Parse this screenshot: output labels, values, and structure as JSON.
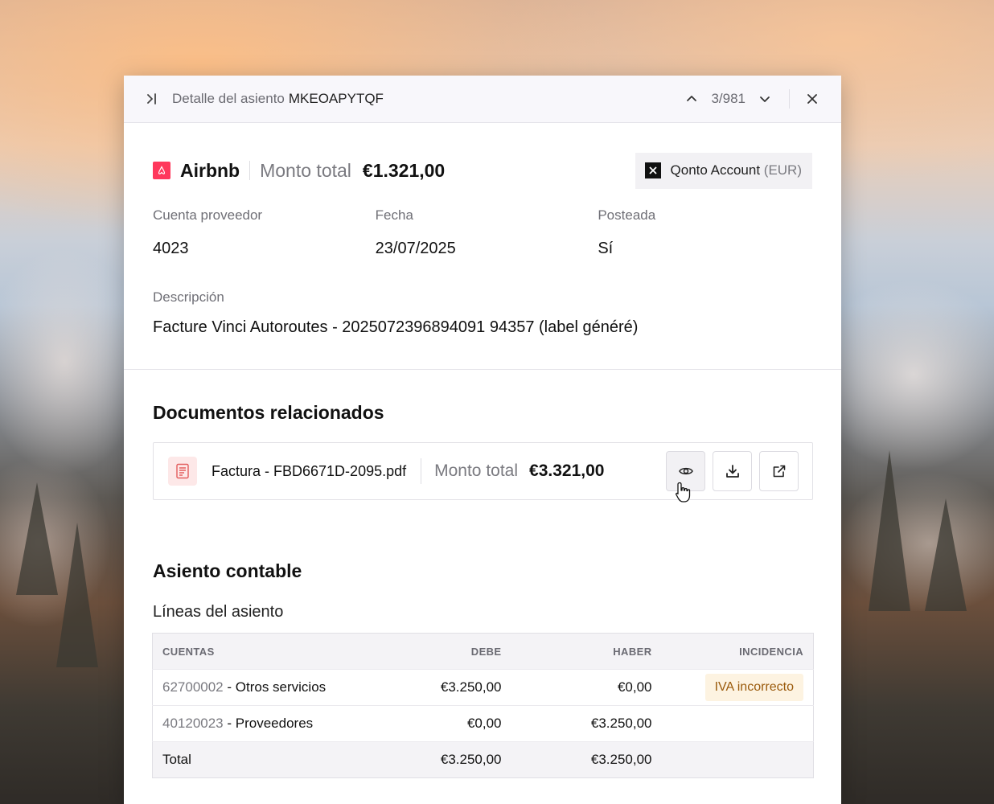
{
  "topbar": {
    "title_prefix": "Detalle del asiento",
    "entry_code": "MKEOAPYTQF",
    "pager": "3/981"
  },
  "entry": {
    "vendor": "Airbnb",
    "total_label": "Monto total",
    "total_value": "€1.321,00",
    "account_name": "Qonto Account",
    "account_currency": "(EUR)",
    "fields": [
      {
        "label": "Cuenta proveedor",
        "value": "4023"
      },
      {
        "label": "Fecha",
        "value": "23/07/2025"
      },
      {
        "label": "Posteada",
        "value": "Sí"
      }
    ],
    "description_label": "Descripción",
    "description_value": "Facture Vinci Autoroutes - 2025072396894091 94357 (label généré)"
  },
  "documents": {
    "title": "Documentos relacionados",
    "items": [
      {
        "name": "Factura - FBD6671D-2095.pdf",
        "total_label": "Monto total",
        "total_value": "€3.321,00"
      }
    ]
  },
  "accounting": {
    "title": "Asiento contable",
    "subtitle": "Líneas del asiento",
    "columns": [
      "CUENTAS",
      "DEBE",
      "HABER",
      "INCIDENCIA"
    ],
    "rows": [
      {
        "code": "62700002",
        "name": "- Otros servicios",
        "debit": "€3.250,00",
        "credit": "€0,00",
        "issue": "IVA incorrecto"
      },
      {
        "code": "40120023",
        "name": "- Proveedores",
        "debit": "€0,00",
        "credit": "€3.250,00",
        "issue": ""
      }
    ],
    "total": {
      "label": "Total",
      "debit": "€3.250,00",
      "credit": "€3.250,00"
    }
  },
  "colors": {
    "accent_vendor": "#ff385c",
    "badge_bg": "#fdf3e1",
    "badge_text": "#9a5a0b"
  }
}
